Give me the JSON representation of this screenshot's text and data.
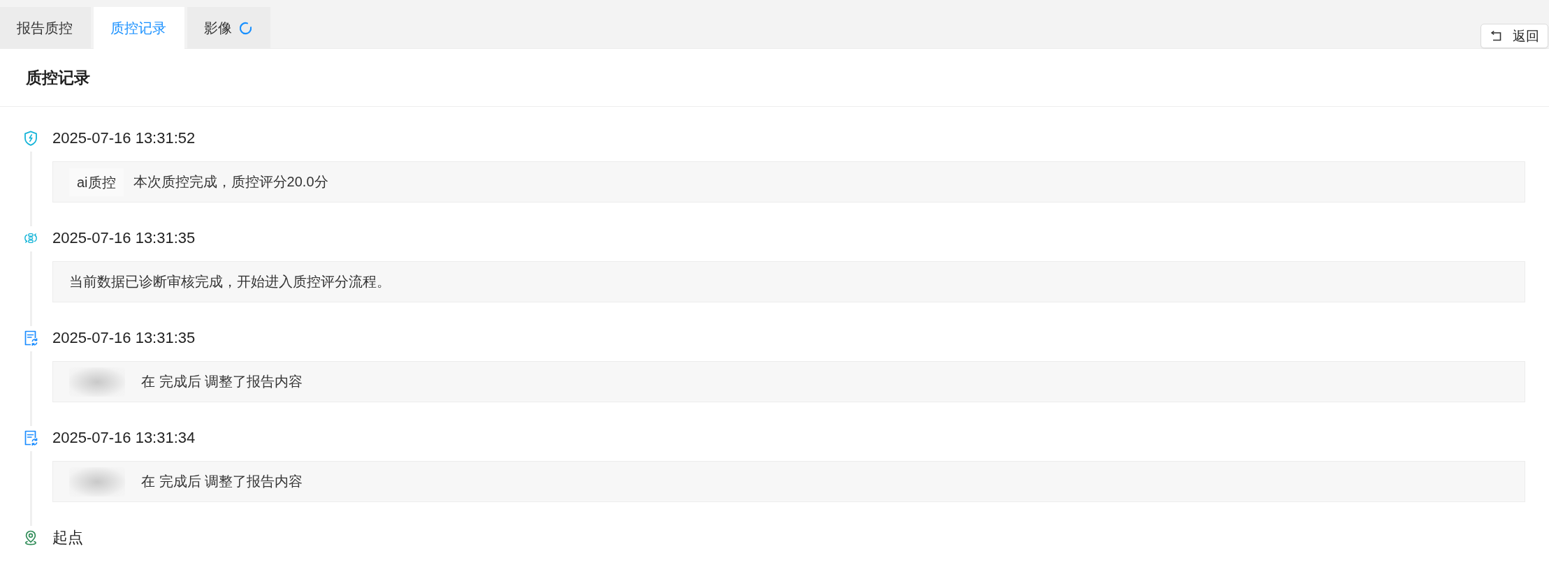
{
  "tabs": [
    {
      "label": "报告质控",
      "selected": false,
      "loading": false
    },
    {
      "label": "质控记录",
      "selected": true,
      "loading": false
    },
    {
      "label": "影像",
      "selected": false,
      "loading": true
    }
  ],
  "back_button": {
    "label": "返回"
  },
  "panel": {
    "title": "质控记录"
  },
  "timeline": {
    "records": [
      {
        "kind": "ai_score",
        "time": "2025-07-16 13:31:52",
        "tag": "ai质控",
        "text": "本次质控完成，质控评分20.0分"
      },
      {
        "kind": "flow",
        "time": "2025-07-16 13:31:35",
        "text": "当前数据已诊断审核完成，开始进入质控评分流程。"
      },
      {
        "kind": "edit",
        "time": "2025-07-16 13:31:35",
        "text": "在 完成后 调整了报告内容"
      },
      {
        "kind": "edit",
        "time": "2025-07-16 13:31:34",
        "text": "在 完成后 调整了报告内容"
      }
    ],
    "start": {
      "label": "起点"
    }
  }
}
